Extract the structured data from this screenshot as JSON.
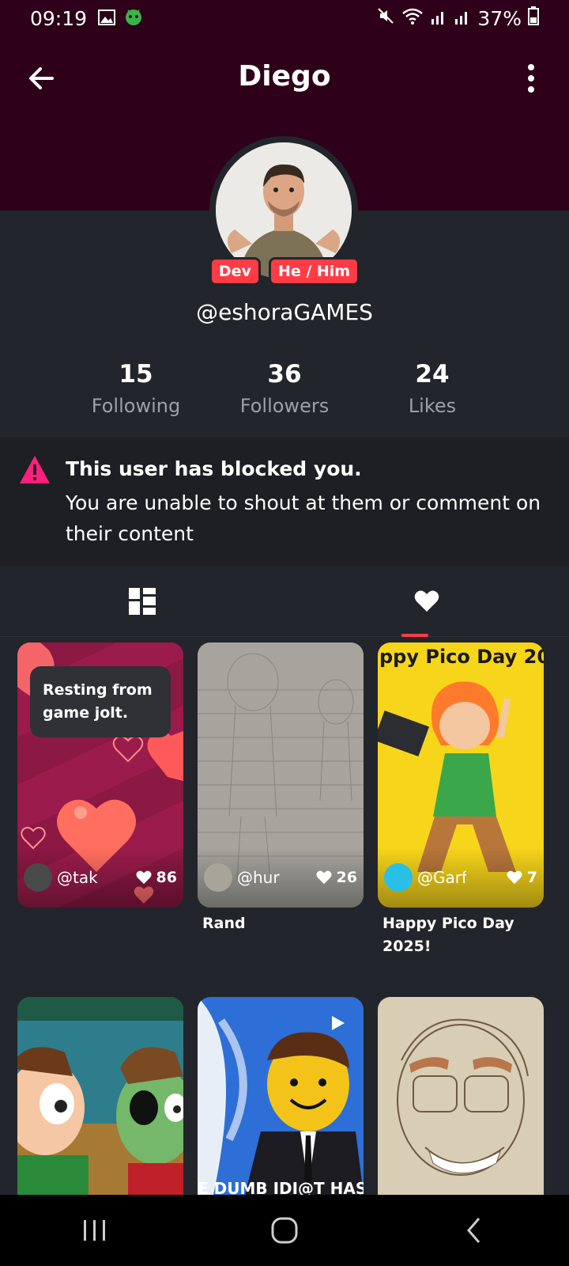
{
  "status_bar": {
    "time": "09:19",
    "battery": "37%",
    "icons": [
      "gallery-icon",
      "android-icon",
      "mute-icon",
      "wifi-icon",
      "signal-icon",
      "signal-icon",
      "battery-icon"
    ]
  },
  "header": {
    "title": "Diego",
    "back_icon": "arrow-left-icon",
    "more_icon": "more-vertical-icon"
  },
  "profile": {
    "tags": [
      "Dev",
      "He / Him"
    ],
    "handle": "@eshoraGAMES"
  },
  "stats": [
    {
      "value": "15",
      "label": "Following"
    },
    {
      "value": "36",
      "label": "Followers"
    },
    {
      "value": "24",
      "label": "Likes"
    }
  ],
  "blocked_notice": {
    "title": "This user has blocked you.",
    "text": "You are unable to shout at them or comment on their content"
  },
  "tabs": [
    {
      "icon": "posts-grid-icon",
      "active": false
    },
    {
      "icon": "heart-icon",
      "active": true
    }
  ],
  "posts": [
    {
      "bubble": "Resting from game jolt.",
      "user": "@tak",
      "likes": "86",
      "caption": ""
    },
    {
      "user": "@hur",
      "likes": "26",
      "caption": "Rand"
    },
    {
      "title_text": "ppy Pico Day 20",
      "user": "@Garf",
      "likes": "7",
      "caption": "Happy Pico Day 2025!"
    }
  ],
  "row2": [
    {
      "overlay_text": ""
    },
    {
      "overlay_text": "E DUMB IDI@T HAS"
    },
    {
      "overlay_text": ""
    }
  ],
  "colors": {
    "header_bg": "#2e0019",
    "page_bg": "#23252c",
    "accent": "#ff3c46",
    "warn": "#ff1f7a"
  }
}
